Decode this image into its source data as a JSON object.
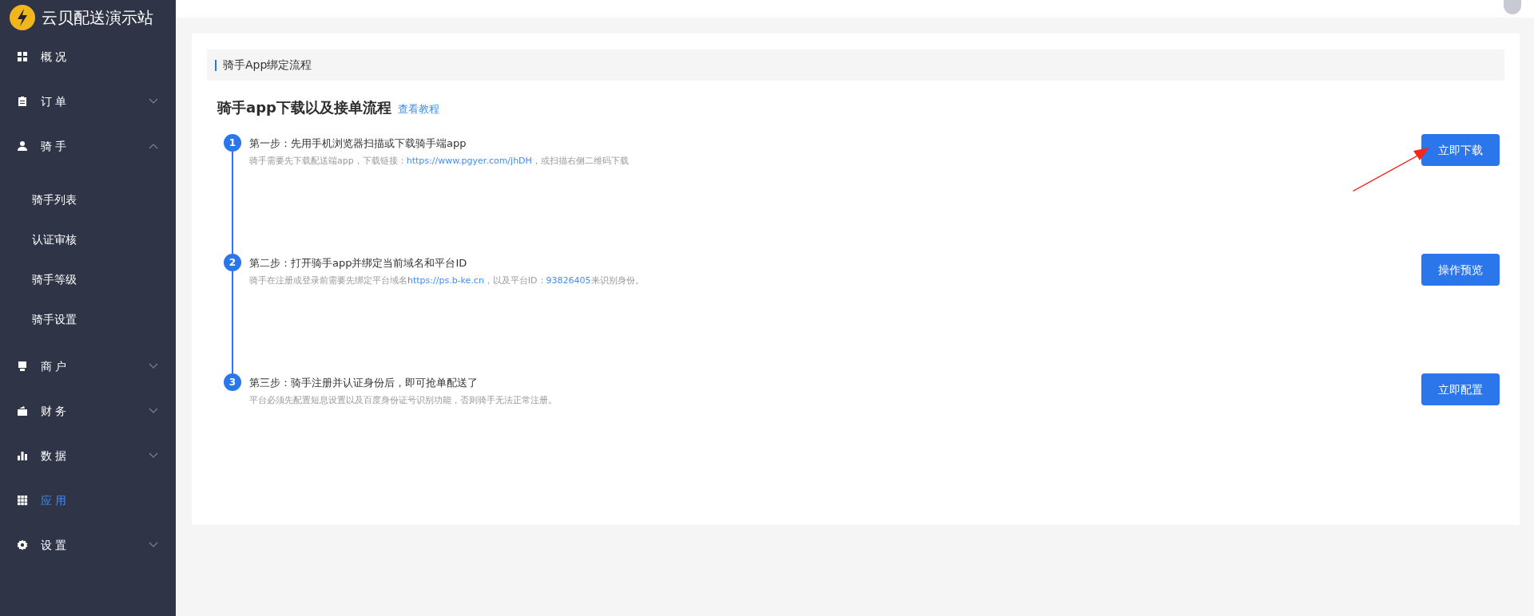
{
  "sidebar": {
    "title": "云贝配送演示站",
    "items": [
      {
        "label": "概况",
        "selected": false
      },
      {
        "label": "订单",
        "selected": false,
        "expanded": false
      },
      {
        "label": "骑手",
        "selected": false,
        "expanded": true,
        "children": [
          {
            "label": "骑手列表"
          },
          {
            "label": "认证审核"
          },
          {
            "label": "骑手等级"
          },
          {
            "label": "骑手设置"
          }
        ]
      },
      {
        "label": "商户",
        "selected": false,
        "expanded": false
      },
      {
        "label": "财务",
        "selected": false,
        "expanded": false
      },
      {
        "label": "数据",
        "selected": false,
        "expanded": false
      },
      {
        "label": "应用",
        "selected": true
      },
      {
        "label": "设置",
        "selected": false,
        "expanded": false
      }
    ]
  },
  "section": {
    "title": "骑手App绑定流程"
  },
  "heading": {
    "title": "骑手app下载以及接单流程",
    "link": "查看教程"
  },
  "steps": [
    {
      "number": "1",
      "title": "第一步：先用手机浏览器扫描或下载骑手端app",
      "description": [
        {
          "kind": "text",
          "text": "骑手需要先下载配送端app，下载链接："
        },
        {
          "kind": "link",
          "text": "https://www.pgyer.com/jhDH"
        },
        {
          "kind": "text",
          "text": "，或扫描右侧二维码下载"
        }
      ],
      "button": "立即下载",
      "annotated": true
    },
    {
      "number": "2",
      "title": "第二步：打开骑手app并绑定当前域名和平台ID",
      "description": [
        {
          "kind": "text",
          "text": "骑手在注册或登录前需要先绑定平台域名"
        },
        {
          "kind": "link",
          "text": "https://ps.b-ke.cn"
        },
        {
          "kind": "text",
          "text": "，以及平台ID："
        },
        {
          "kind": "link",
          "text": "93826405"
        },
        {
          "kind": "text",
          "text": "来识别身份。"
        }
      ],
      "button": "操作预览",
      "annotated": false
    },
    {
      "number": "3",
      "title": "第三步：骑手注册并认证身份后，即可抢单配送了",
      "description": [
        {
          "kind": "text",
          "text": "平台必须先配置短息设置以及百度身份证号识别功能，否则骑手无法正常注册。"
        }
      ],
      "button": "立即配置",
      "annotated": false
    }
  ]
}
